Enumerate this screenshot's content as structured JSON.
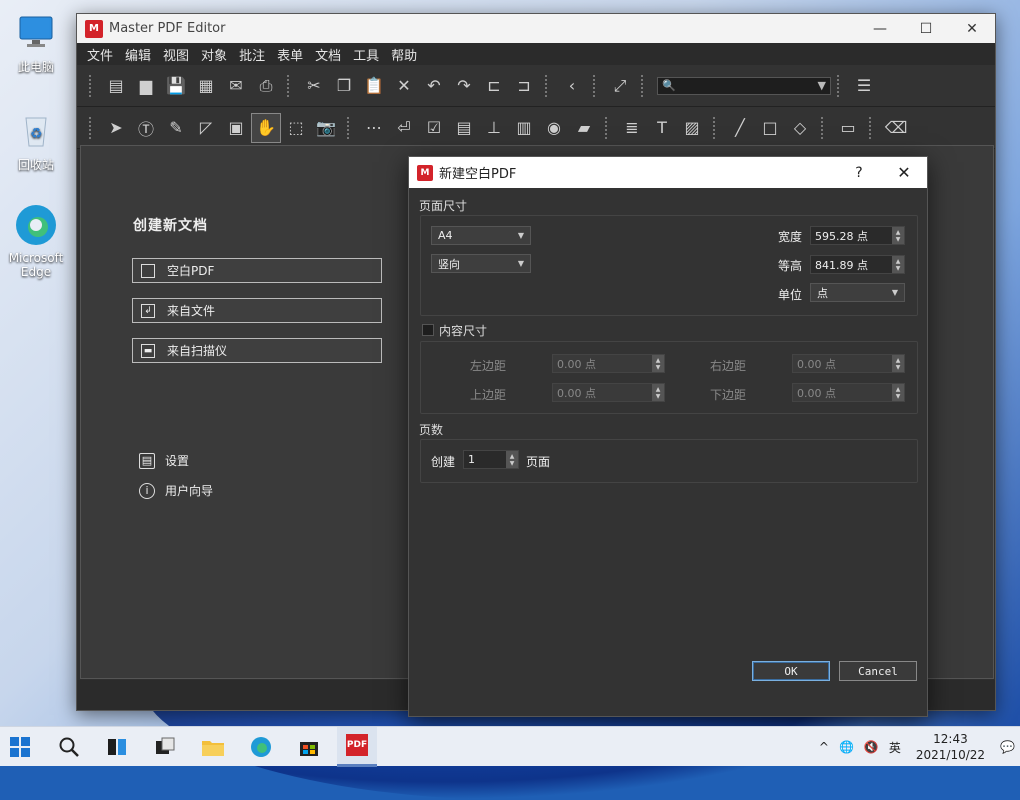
{
  "desktop": {
    "icons": [
      {
        "label": "此电脑",
        "icon": "computer-icon"
      },
      {
        "label": "回收站",
        "icon": "recycle-bin-icon"
      },
      {
        "label": "Microsoft Edge",
        "icon": "edge-icon"
      }
    ]
  },
  "window": {
    "title": "Master PDF Editor",
    "logo_text": "PDF",
    "controls": {
      "minimize": "—",
      "maximize": "☐",
      "close": "✕"
    }
  },
  "menu": [
    "文件",
    "编辑",
    "视图",
    "对象",
    "批注",
    "表单",
    "文档",
    "工具",
    "帮助"
  ],
  "search": {
    "icon": "search-icon",
    "value": "🔍"
  },
  "start_page": {
    "title": "创建新文档",
    "buttons": [
      {
        "label": "空白PDF",
        "icon": "blank-page-icon"
      },
      {
        "label": "来自文件",
        "icon": "file-import-icon"
      },
      {
        "label": "来自扫描仪",
        "icon": "scanner-icon"
      }
    ],
    "links": [
      {
        "label": "设置",
        "icon": "settings-icon"
      },
      {
        "label": "用户向导",
        "icon": "info-icon"
      }
    ]
  },
  "dialog": {
    "title": "新建空白PDF",
    "help": "?",
    "close": "✕",
    "page_size_section": "页面尺寸",
    "paper": "A4",
    "orientation": "竖向",
    "width_label": "宽度",
    "width_value": "595.28 点",
    "height_label": "等高",
    "height_value": "841.89 点",
    "unit_label": "单位",
    "unit_value": "点",
    "content_size_label": "内容尺寸",
    "content_size_checked": false,
    "left_margin_label": "左边距",
    "left_margin_value": "0.00 点",
    "right_margin_label": "右边距",
    "right_margin_value": "0.00 点",
    "top_margin_label": "上边距",
    "top_margin_value": "0.00 点",
    "bottom_margin_label": "下边距",
    "bottom_margin_value": "0.00 点",
    "pages_section": "页数",
    "create_label": "创建",
    "pages_value": "1",
    "pages_unit": "页面",
    "ok": "OK",
    "cancel": "Cancel"
  },
  "taskbar": {
    "time": "12:43",
    "date": "2021/10/22",
    "ime": "英",
    "tray_up": "^"
  },
  "colors": {
    "brand": "#d3232a",
    "dialog_bg": "#333333",
    "accent": "#7ab0e0"
  }
}
